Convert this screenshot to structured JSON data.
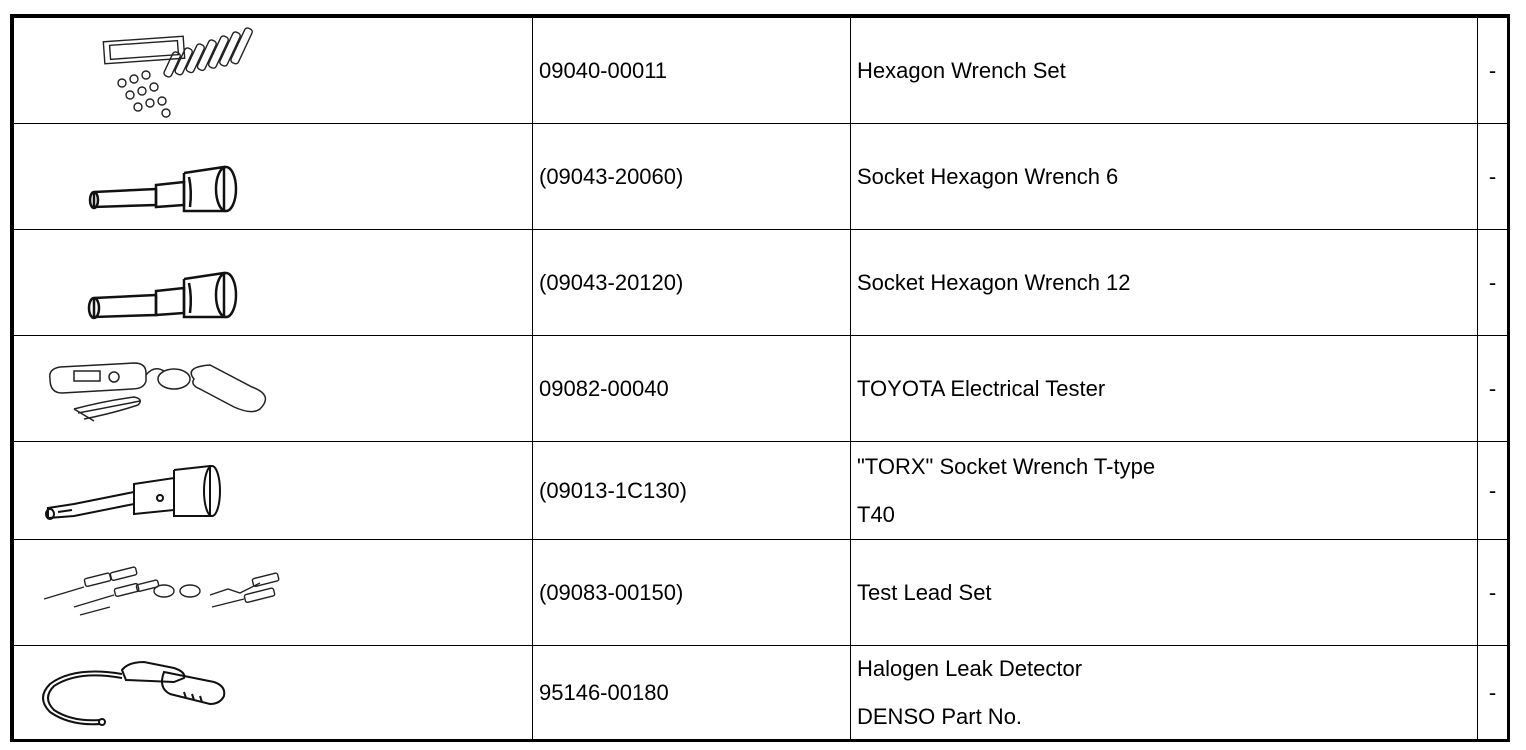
{
  "rows": [
    {
      "icon": "hexagon-wrench-set-icon",
      "part_no": "09040-00011",
      "name": "Hexagon Wrench Set",
      "name2": "",
      "note": "-"
    },
    {
      "icon": "socket-hexagon-wrench-icon",
      "part_no": "(09043-20060)",
      "name": "Socket Hexagon Wrench 6",
      "name2": "",
      "note": "-"
    },
    {
      "icon": "socket-hexagon-wrench-icon",
      "part_no": "(09043-20120)",
      "name": "Socket Hexagon Wrench 12",
      "name2": "",
      "note": "-"
    },
    {
      "icon": "electrical-tester-icon",
      "part_no": "09082-00040",
      "name": "TOYOTA Electrical Tester",
      "name2": "",
      "note": "-"
    },
    {
      "icon": "torx-socket-wrench-icon",
      "part_no": "(09013-1C130)",
      "name": "\"TORX\" Socket Wrench T-type",
      "name2": "T40",
      "note": "-"
    },
    {
      "icon": "test-lead-set-icon",
      "part_no": "(09083-00150)",
      "name": "Test Lead Set",
      "name2": "",
      "note": "-"
    },
    {
      "icon": "halogen-leak-detector-icon",
      "part_no": "95146-00180",
      "name": "Halogen Leak Detector",
      "name2": "DENSO Part No.",
      "note": "-"
    }
  ]
}
